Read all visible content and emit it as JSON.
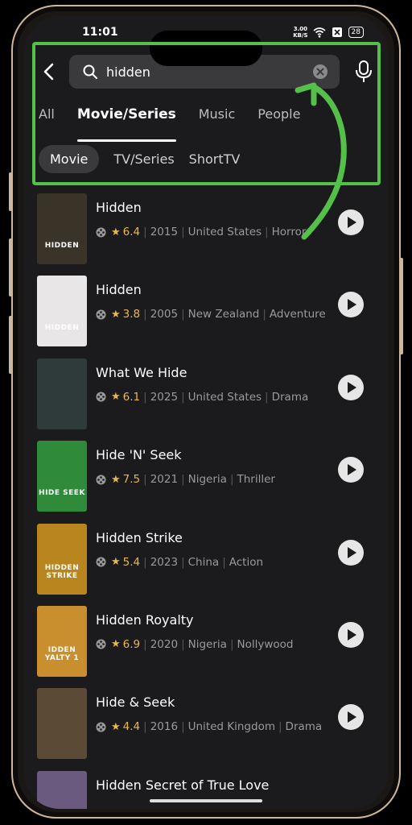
{
  "status": {
    "time": "11:01",
    "speed_value": "3.00",
    "speed_unit": "KB/S",
    "battery": "28"
  },
  "search": {
    "query": "hidden"
  },
  "tabs": [
    {
      "label": "All"
    },
    {
      "label": "Movie/Series"
    },
    {
      "label": "Music"
    },
    {
      "label": "People"
    }
  ],
  "subtabs": [
    {
      "label": "Movie"
    },
    {
      "label": "TV/Series"
    },
    {
      "label": "ShortTV"
    }
  ],
  "results": [
    {
      "title": "Hidden",
      "rating": "6.4",
      "year": "2015",
      "country": "United States",
      "genre": "Horror",
      "poster_text": "HIDDEN",
      "poster_color": "#3a3328"
    },
    {
      "title": "Hidden",
      "rating": "3.8",
      "year": "2005",
      "country": "New Zealand",
      "genre": "Adventure",
      "poster_text": "HIDDEN",
      "poster_color": "#e8e6e6"
    },
    {
      "title": "What We Hide",
      "rating": "6.1",
      "year": "2025",
      "country": "United States",
      "genre": "Drama",
      "poster_text": "",
      "poster_color": "#2f3a3a"
    },
    {
      "title": "Hide 'N' Seek",
      "rating": "7.5",
      "year": "2021",
      "country": "Nigeria",
      "genre": "Thriller",
      "poster_text": "HIDE SEEK",
      "poster_color": "#2f8a3a"
    },
    {
      "title": "Hidden Strike",
      "rating": "5.4",
      "year": "2023",
      "country": "China",
      "genre": "Action",
      "poster_text": "HIDDEN STRIKE",
      "poster_color": "#b8851f"
    },
    {
      "title": "Hidden Royalty",
      "rating": "6.9",
      "year": "2020",
      "country": "Nigeria",
      "genre": "Nollywood",
      "poster_text": "IDDEN YALTY 1",
      "poster_color": "#c98e2e"
    },
    {
      "title": "Hide & Seek",
      "rating": "4.4",
      "year": "2016",
      "country": "United Kingdom",
      "genre": "Drama",
      "poster_text": "",
      "poster_color": "#5a4a36"
    },
    {
      "title": "Hidden Secret of True Love",
      "rating": "",
      "year": "",
      "country": "",
      "genre": "",
      "poster_text": "",
      "poster_color": "#6a5a80"
    }
  ],
  "colors": {
    "highlight": "#54c04a",
    "accent_star": "#e9b84a",
    "background": "#1b1b1d"
  }
}
